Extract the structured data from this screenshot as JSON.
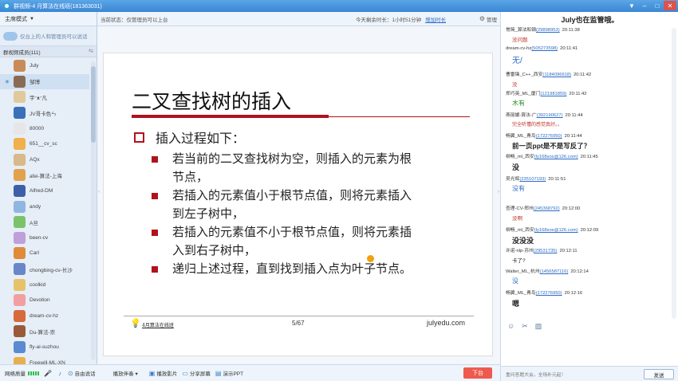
{
  "window": {
    "title": "群视频-4 月算法在线班(181363031)",
    "buttons": [
      "▼",
      "–",
      "□",
      "✕"
    ]
  },
  "sidebar": {
    "mode_label": "主席模式",
    "notice": "仅台上的人和管理员可以说话",
    "members_header": "群视频成员(111)",
    "members": [
      {
        "name": "July",
        "color": "#c98b5a"
      },
      {
        "name": "邹博",
        "color": "#8a6a55",
        "active": true,
        "mic": true
      },
      {
        "name": "宇ᵔᴥᵔ凡",
        "color": "#e0c99a"
      },
      {
        "name": "JV哥卡色ㄣ",
        "color": "#3a70b8"
      },
      {
        "name": "80000",
        "color": "#e6e6e6"
      },
      {
        "name": "651__cv_sc",
        "color": "#f0b04a"
      },
      {
        "name": "AQx",
        "color": "#d9b889"
      },
      {
        "name": "afei-算法-上海",
        "color": "#e2a24c"
      },
      {
        "name": "Alfred-DM",
        "color": "#3d5fa8"
      },
      {
        "name": "andy",
        "color": "#8fb6e0"
      },
      {
        "name": "A旦",
        "color": "#7bc36b"
      },
      {
        "name": "been-cv",
        "color": "#c0a0d8"
      },
      {
        "name": "Carl",
        "color": "#e08a3a"
      },
      {
        "name": "chongbing-cv-长沙",
        "color": "#6a86c8"
      },
      {
        "name": "coolkid",
        "color": "#e8c26a"
      },
      {
        "name": "Devotion",
        "color": "#f0a0a0"
      },
      {
        "name": "dream-cv-hz",
        "color": "#d8693a"
      },
      {
        "name": "Du-算法-崇",
        "color": "#9a5a3a"
      },
      {
        "name": "fly-ai-suzhou",
        "color": "#5a8ad0"
      },
      {
        "name": "Freewill-ML-XN",
        "color": "#e8b04a"
      }
    ]
  },
  "topbar": {
    "status": "当前状态：仅管理员可以上台",
    "timer_label": "今天剩余时长：1小时51分钟",
    "add_time": "增加时长",
    "manage": "管理"
  },
  "slide": {
    "title": "二叉查找树的插入",
    "heading": "插入过程如下：",
    "bullets": [
      {
        "line1": "若当前的二叉查找树为空，则插入的元素为根",
        "line2": "节点，"
      },
      {
        "line1": "若插入的元素值小于根节点值，则将元素插入",
        "line2": "到左子树中，"
      },
      {
        "line1": "若插入的元素值不小于根节点值，则将元素插",
        "line2": "入到右子树中，"
      },
      {
        "line1": "递归上述过程，直到找到插入点为叶子节点。",
        "line2": ""
      }
    ],
    "brand": "4月算法在线班",
    "page": "5/67",
    "site": "julyedu.com"
  },
  "chat": {
    "announce": "July也在监管哦。",
    "messages": [
      {
        "name": "常简_算法和钢",
        "uid": "(29898953)",
        "time": "20:11:38",
        "text": "没问题",
        "color": "#c0392b",
        "size": 6.5,
        "bold": false
      },
      {
        "name": "dream-cv-hz",
        "uid": "(505273598)",
        "time": "20:11:41",
        "text": "无/",
        "color": "#2b6cc4",
        "size": 10,
        "bold": false
      },
      {
        "name": "曹雷锋_C++_西安",
        "uid": "(1184096618)",
        "time": "20:11:42",
        "text": "没",
        "color": "#c0392b",
        "size": 6.5,
        "bold": false
      },
      {
        "name": "郑巧英_ML_厦门",
        "uid": "(121981859)",
        "time": "20:11:42",
        "text": "木有",
        "color": "#2a8a2a",
        "size": 8,
        "bold": false
      },
      {
        "name": "燕丽媛-算法-广",
        "uid": "(392190627)",
        "time": "20:11:44",
        "text": "完全听懂的感觉真好。。",
        "color": "#c0392b",
        "size": 6,
        "bold": false
      },
      {
        "name": "畅翼_ML_青岛",
        "uid": "(172276950)",
        "time": "20:11:44",
        "text": "前一页ppt是不是写反了？",
        "color": "#222",
        "size": 8.5,
        "bold": true
      },
      {
        "name": "柳畅_ml_西安",
        "uid": "(ly168sos@126.com)",
        "time": "20:11:45",
        "text": "没",
        "color": "#222",
        "size": 9,
        "bold": true
      },
      {
        "name": "吴光辉",
        "uid": "(235107193)",
        "time": "20:11:51",
        "text": "没有",
        "color": "#2b6cc4",
        "size": 8,
        "bold": false
      },
      {
        "name": "查理-CV-郑州",
        "uid": "(245368792)",
        "time": "20:12:00",
        "text": "没啊",
        "color": "#c0392b",
        "size": 6.5,
        "bold": false
      },
      {
        "name": "柳畅_ml_西安",
        "uid": "(ly168sos@126.com)",
        "time": "20:12:09",
        "text": "没没没",
        "color": "#222",
        "size": 9,
        "bold": true
      },
      {
        "name": "许诺-nlp-苏州",
        "uid": "(29531735)",
        "time": "20:12:11",
        "text": "卡了?",
        "color": "#222",
        "size": 6.5,
        "bold": false
      },
      {
        "name": "Walter_ML_杭州",
        "uid": "(1456587116)",
        "time": "20:12:14",
        "text": "没",
        "color": "#2b6cc4",
        "size": 8,
        "bold": false
      },
      {
        "name": "畅翼_ML_青岛",
        "uid": "(172276950)",
        "time": "20:12:16",
        "text": "嗯",
        "color": "#222",
        "size": 9,
        "bold": true
      }
    ],
    "input_hint": "重问答题大会，全场补元起！",
    "send_label": "发送"
  },
  "bottombar": {
    "net_label": "网络质量",
    "items": [
      {
        "icon": "♪",
        "label": ""
      },
      {
        "icon": "⊙",
        "label": "自由说话"
      },
      {
        "icon": "",
        "label": "播放伴奏 ▾"
      },
      {
        "icon": "▣",
        "label": "播放影片"
      },
      {
        "icon": "▭",
        "label": "分享屏幕"
      },
      {
        "icon": "▤",
        "label": "演示PPT"
      }
    ],
    "leave_label": "下台"
  },
  "colors": {
    "accent": "#3b86d4",
    "slide_red": "#b0121d",
    "leave": "#ee5a4f"
  }
}
